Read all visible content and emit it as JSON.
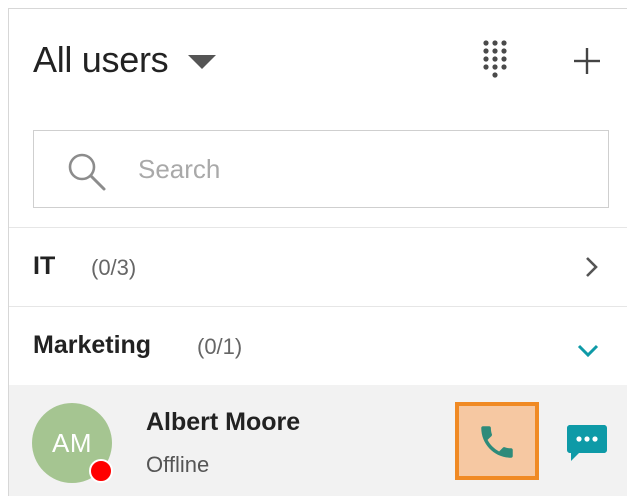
{
  "header": {
    "title": "All users",
    "icons": {
      "dropdown": "caret-down-icon",
      "dialpad": "dialpad-icon",
      "add": "plus-icon"
    }
  },
  "search": {
    "placeholder": "Search",
    "value": "",
    "icon": "search-icon"
  },
  "groups": [
    {
      "name": "IT",
      "count": "(0/3)",
      "expanded": false,
      "chevron": "chevron-right-icon"
    },
    {
      "name": "Marketing",
      "count": "(0/1)",
      "expanded": true,
      "chevron": "chevron-down-icon"
    }
  ],
  "users": [
    {
      "initials": "AM",
      "name": "Albert Moore",
      "status": "Offline",
      "status_color": "#ff0000",
      "avatar_color": "#a5c591",
      "actions": {
        "call": "phone-icon",
        "chat": "chat-icon"
      }
    }
  ],
  "colors": {
    "accent": "#0e9aa7",
    "highlight_border": "#f08a24",
    "highlight_fill": "#f6c8a2",
    "phone_icon": "#2e8b7a"
  }
}
